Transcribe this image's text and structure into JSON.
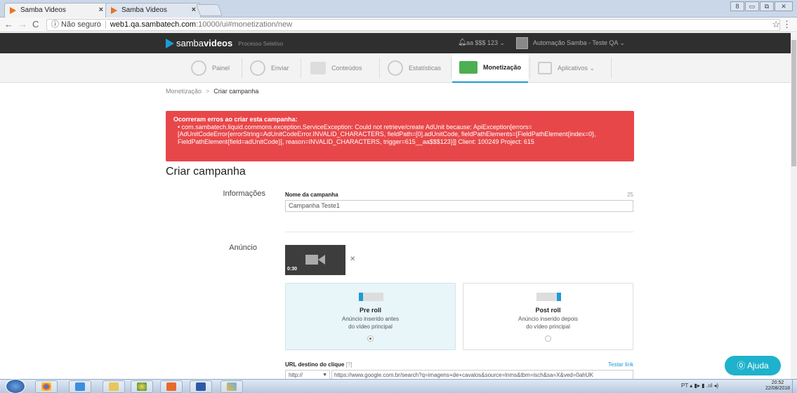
{
  "browser": {
    "tabs": [
      {
        "title": "Samba Videos",
        "close": "×"
      },
      {
        "title": "Samba Videos",
        "close": "×"
      }
    ],
    "window_controls": [
      "8",
      "▭",
      "⧉",
      "✕"
    ],
    "address": {
      "security": "ⓘ Não seguro",
      "host": "web1.qa.sambatech.com",
      "path": ":10000/ui#monetization/new"
    }
  },
  "app": {
    "logo_prefix": "samba",
    "logo_bold": "videos",
    "logo_sub": "Processo Seletivo",
    "account": "aa $$$ 123 ⌄",
    "user": "Automação Samba - Teste QA ⌄"
  },
  "modules": [
    {
      "label": "Painel"
    },
    {
      "label": "Enviar"
    },
    {
      "label": "Conteúdos"
    },
    {
      "label": "Estatísticas"
    },
    {
      "label": "Monetização",
      "active": true
    },
    {
      "label": "Aplicativos ⌄"
    }
  ],
  "breadcrumb": {
    "parent": "Monetização",
    "current": "Criar campanha"
  },
  "alert": {
    "title": "Ocorreram erros ao criar esta campanha:",
    "message": "• com.sambatech.liquid.commons.exception.ServiceException: Could not retrieve/create AdUnit because: ApiException[errors=[AdUnitCodeError{errorString=AdUnitCodeError.INVALID_CHARACTERS, fieldPath=[0].adUnitCode, fieldPathElements=[FieldPathElement{index=0}, FieldPathElement{field=adUnitCode}], reason=INVALID_CHARACTERS, trigger=615__aa$$$123}]] Client: 100249 Project: 615"
  },
  "page_title": "Criar campanha",
  "info": {
    "section_label": "Informações",
    "field_label": "Nome da campanha",
    "counter": "25",
    "value": "Campanha Teste1"
  },
  "ad": {
    "section_label": "Anúncio",
    "duration": "0:30",
    "remove": "✕",
    "options": [
      {
        "title": "Pre roll",
        "desc1": "Anúncio inserido antes",
        "desc2": "do vídeo principal",
        "selected": true
      },
      {
        "title": "Post roll",
        "desc1": "Anúncio inserido depois",
        "desc2": "do vídeo principal",
        "selected": false
      }
    ]
  },
  "url": {
    "label": "URL destino do clique",
    "help": "[?]",
    "test_link": "Testar link",
    "protocol": "http://",
    "value": "https://www.google.com.br/search?q=imagens+de+cavalos&source=lnms&tbm=isch&sa=X&ved=0ahUK"
  },
  "help_button": "⓪ Ajuda",
  "taskbar": {
    "tray": "PT  ▴  ▮▸  ▮  .ııl  ◂)",
    "time": "20:52",
    "date": "22/08/2018"
  }
}
